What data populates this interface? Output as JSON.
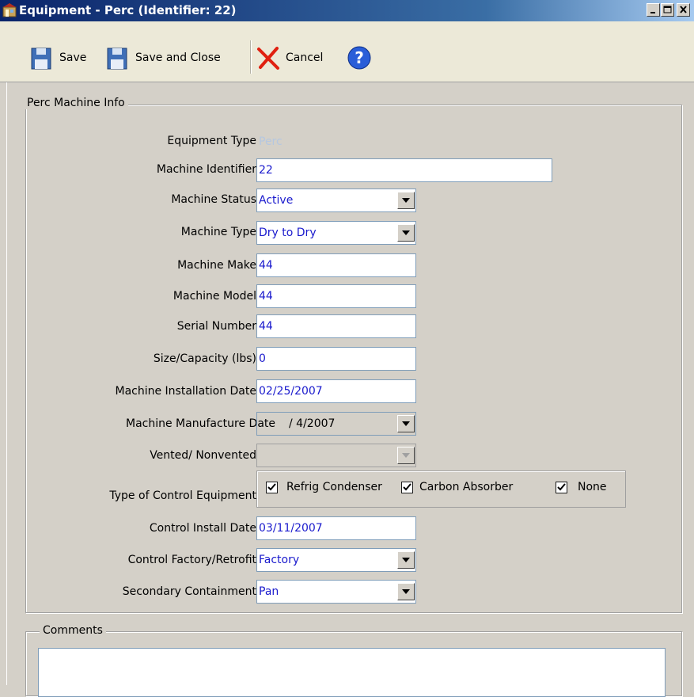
{
  "window": {
    "title": "Equipment - Perc (Identifier: 22)",
    "controls": [
      "minimize",
      "maximize",
      "close"
    ]
  },
  "toolbar": {
    "save_label": "Save",
    "save_close_label": "Save and Close",
    "cancel_label": "Cancel",
    "help_icon": "help-icon"
  },
  "perc_group": {
    "legend": "Perc Machine Info",
    "fields": {
      "equipment_type": {
        "label": "Equipment Type",
        "value": "Perc"
      },
      "machine_identifier": {
        "label": "Machine Identifier",
        "value": "22"
      },
      "machine_status": {
        "label": "Machine Status",
        "value": "Active"
      },
      "machine_type": {
        "label": "Machine Type",
        "value": "Dry to Dry"
      },
      "machine_make": {
        "label": "Machine Make",
        "value": "44"
      },
      "machine_model": {
        "label": "Machine Model",
        "value": "44"
      },
      "serial_number": {
        "label": "Serial Number",
        "value": "44"
      },
      "size_capacity": {
        "label": "Size/Capacity (lbs)",
        "value": "0"
      },
      "installation_date": {
        "label": "Machine Installation Date",
        "value": "02/25/2007"
      },
      "manufacture_date": {
        "label": "Machine Manufacture Date",
        "value": "/ 4/2007"
      },
      "vented": {
        "label": "Vented/ Nonvented",
        "value": ""
      },
      "control_equipment": {
        "label": "Type of Control Equipment",
        "options": [
          {
            "label": "Refrig Condenser",
            "checked": true
          },
          {
            "label": "Carbon Absorber",
            "checked": true
          },
          {
            "label": "None",
            "checked": true
          }
        ]
      },
      "control_install_date": {
        "label": "Control Install Date",
        "value": "03/11/2007"
      },
      "control_factory_retrofit": {
        "label": "Control Factory/Retrofit",
        "value": "Factory"
      },
      "secondary_containment": {
        "label": "Secondary Containment",
        "value": "Pan"
      }
    }
  },
  "comments_group": {
    "legend": "Comments",
    "value": ""
  },
  "colors": {
    "title_bar": "#0a246a",
    "value_text": "#1a1acd",
    "panel": "#d4d0c8"
  }
}
